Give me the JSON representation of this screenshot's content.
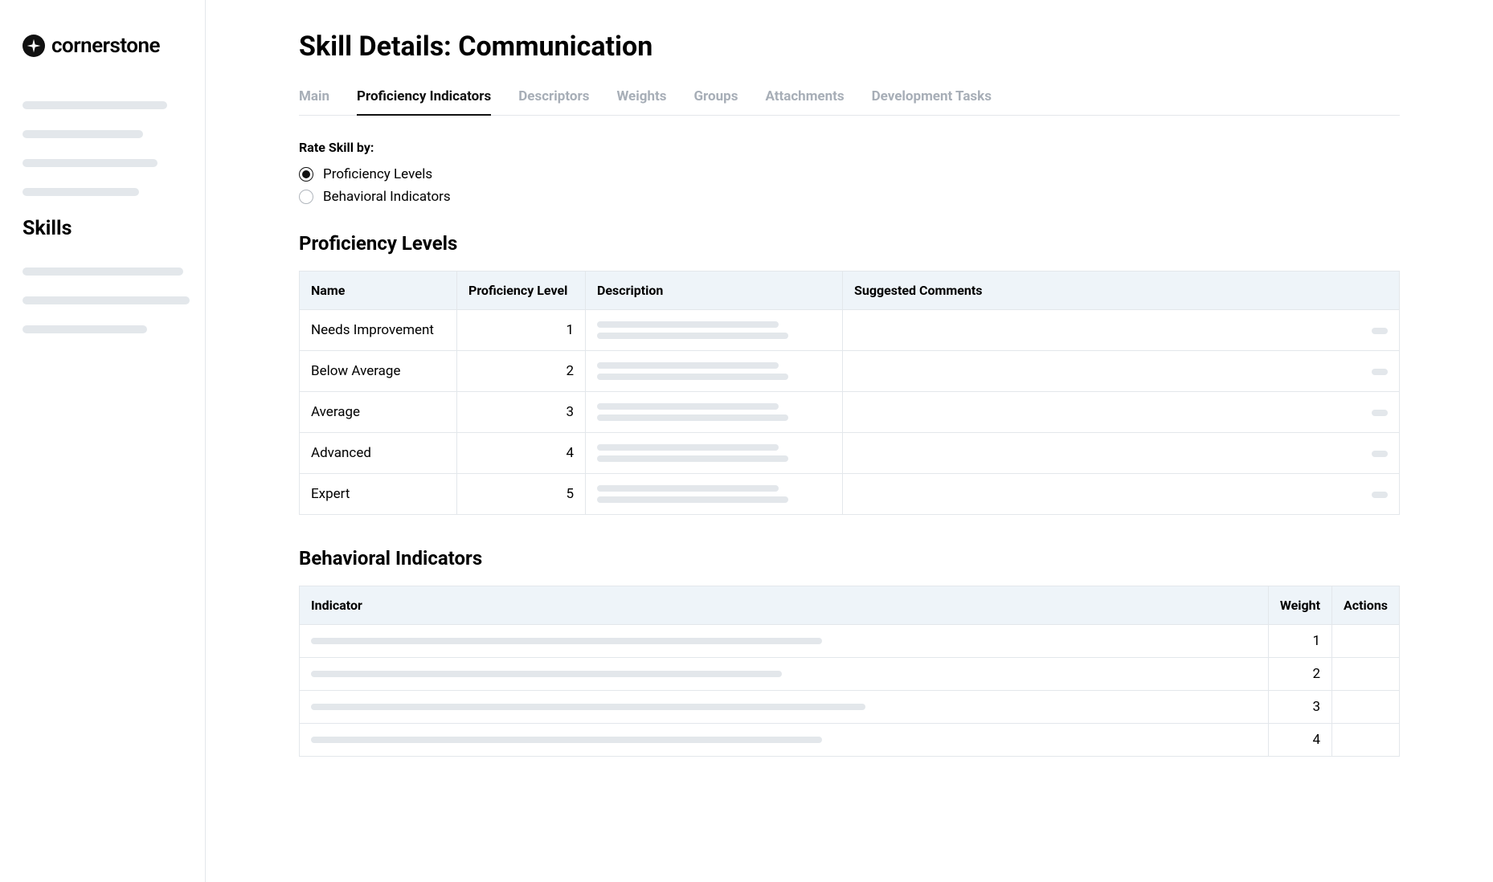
{
  "brand": {
    "name": "cornerstone"
  },
  "sidebar": {
    "active_section": "Skills"
  },
  "page": {
    "title_prefix": "Skill Details: ",
    "title_value": "Communication"
  },
  "tabs": [
    {
      "id": "main",
      "label": "Main",
      "active": false
    },
    {
      "id": "proficiency",
      "label": "Proficiency Indicators",
      "active": true
    },
    {
      "id": "descriptors",
      "label": "Descriptors",
      "active": false
    },
    {
      "id": "weights",
      "label": "Weights",
      "active": false
    },
    {
      "id": "groups",
      "label": "Groups",
      "active": false
    },
    {
      "id": "attachments",
      "label": "Attachments",
      "active": false
    },
    {
      "id": "devtasks",
      "label": "Development Tasks",
      "active": false
    }
  ],
  "rate_skill": {
    "label": "Rate Skill by:",
    "options": [
      {
        "id": "levels",
        "label": "Proficiency Levels",
        "selected": true
      },
      {
        "id": "behavioral",
        "label": "Behavioral Indicators",
        "selected": false
      }
    ]
  },
  "proficiency_section": {
    "heading": "Proficiency Levels",
    "columns": {
      "name": "Name",
      "level": "Proficiency Level",
      "description": "Description",
      "suggested": "Suggested Comments"
    },
    "rows": [
      {
        "name": "Needs Improvement",
        "level": "1"
      },
      {
        "name": "Below Average",
        "level": "2"
      },
      {
        "name": "Average",
        "level": "3"
      },
      {
        "name": "Advanced",
        "level": "4"
      },
      {
        "name": "Expert",
        "level": "5"
      }
    ]
  },
  "behavioral_section": {
    "heading": "Behavioral Indicators",
    "columns": {
      "indicator": "Indicator",
      "weight": "Weight",
      "actions": "Actions"
    },
    "rows": [
      {
        "weight": "1"
      },
      {
        "weight": "2"
      },
      {
        "weight": "3"
      },
      {
        "weight": "4"
      }
    ]
  }
}
